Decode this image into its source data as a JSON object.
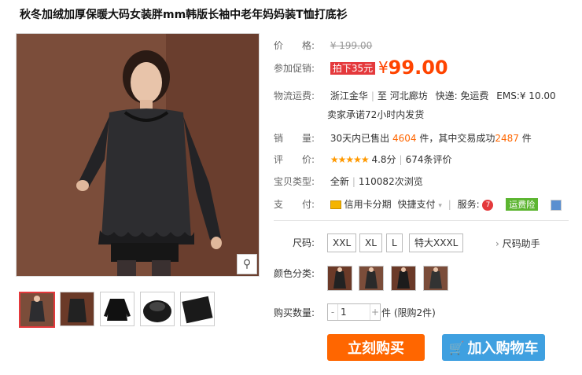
{
  "title": "秋冬加绒加厚保暖大码女装胖mm韩版长袖中老年妈妈装T恤打底衫",
  "price": {
    "label": "价　　格:",
    "original": "¥ 199.00"
  },
  "promo": {
    "label": "参加促销:",
    "tag": "拍下35元",
    "yen": "¥",
    "value": "99.00"
  },
  "shipping": {
    "label": "物流运费:",
    "from": "浙江金华",
    "sep": "至",
    "to": "河北廊坊",
    "express": "快递: 免运费",
    "ems": "EMS:¥ 10.00",
    "promise": "卖家承诺72小时内发货"
  },
  "sales": {
    "label": "销　　量:",
    "prefix": "30天内已售出",
    "count": "4604",
    "mid": "件，其中交易成功",
    "success": "2487",
    "suffix": "件"
  },
  "rating": {
    "label": "评　　价:",
    "stars": "★★★★★",
    "score": "4.8分",
    "reviews": "674条评价"
  },
  "condition": {
    "label": "宝贝类型:",
    "value": "全新",
    "views": "110082次浏览"
  },
  "payment": {
    "label": "支　　付:",
    "credit": "信用卡分期",
    "quick": "快捷支付",
    "service_label": "服务:",
    "badge": "运费险"
  },
  "size": {
    "label": "尺码:",
    "options": [
      "XXL",
      "XL",
      "L",
      "特大XXXL"
    ],
    "helper": "尺码助手"
  },
  "colors": {
    "label": "颜色分类:"
  },
  "quantity": {
    "label": "购买数量:",
    "value": "1",
    "minus": "-",
    "plus": "+",
    "note": "件 (限购2件)"
  },
  "buttons": {
    "buy": "立刻购买",
    "cart": "加入购物车"
  },
  "accent_colors": {
    "price": "#ff4400",
    "buy": "#ff6600",
    "cart": "#3fa0e0"
  }
}
